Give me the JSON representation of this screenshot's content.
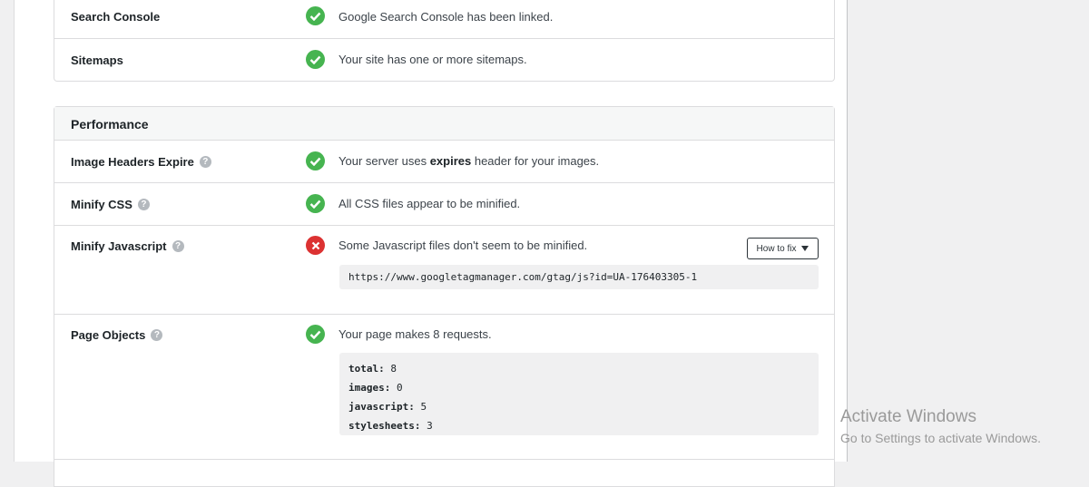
{
  "top_section": {
    "rows": [
      {
        "label": "Search Console",
        "status": "pass",
        "message": "Google Search Console has been linked."
      },
      {
        "label": "Sitemaps",
        "status": "pass",
        "message": "Your site has one or more sitemaps."
      }
    ]
  },
  "performance": {
    "title": "Performance",
    "image_headers": {
      "label": "Image Headers Expire",
      "status": "pass",
      "msg_pre": "Your server uses ",
      "msg_bold": "expires",
      "msg_post": " header for your images."
    },
    "minify_css": {
      "label": "Minify CSS",
      "status": "pass",
      "message": "All CSS files appear to be minified."
    },
    "minify_js": {
      "label": "Minify Javascript",
      "status": "fail",
      "message": "Some Javascript files don't seem to be minified.",
      "how_to_fix": "How to fix",
      "url": "https://www.googletagmanager.com/gtag/js?id=UA-176403305-1"
    },
    "page_objects": {
      "label": "Page Objects",
      "status": "pass",
      "message": "Your page makes 8 requests.",
      "stats": [
        {
          "key": "total:",
          "value": "8"
        },
        {
          "key": "images:",
          "value": "0"
        },
        {
          "key": "javascript:",
          "value": "5"
        },
        {
          "key": "stylesheets:",
          "value": "3"
        }
      ]
    }
  },
  "watermark": {
    "line1": "Activate Windows",
    "line2": "Go to Settings to activate Windows."
  },
  "colors": {
    "pass": "#46b450",
    "fail": "#dc3232"
  }
}
